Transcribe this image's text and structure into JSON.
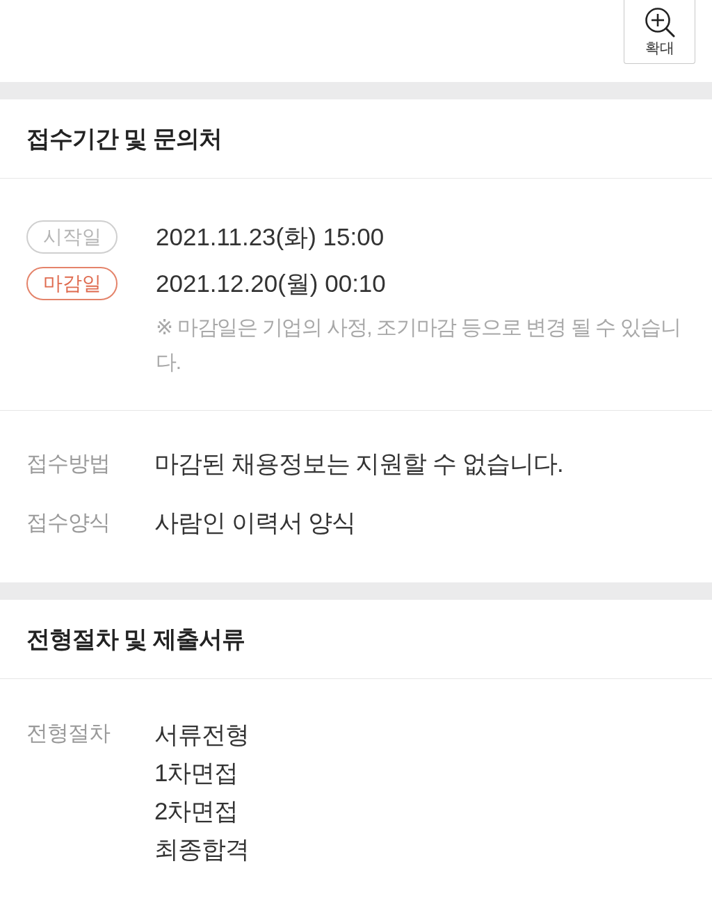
{
  "zoom_button": {
    "label": "확대"
  },
  "sections": [
    {
      "title": "접수기간 및 문의처",
      "schedule": [
        {
          "kind": "start",
          "label": "시작일",
          "value": "2021.11.23(화) 15:00"
        },
        {
          "kind": "deadline",
          "label": "마감일",
          "value": "2021.12.20(월) 00:10"
        }
      ],
      "note": "※ 마감일은 기업의 사정, 조기마감 등으로 변경 될 수 있습니다.",
      "fields": [
        {
          "label": "접수방법",
          "values": [
            "마감된 채용정보는 지원할 수 없습니다."
          ]
        },
        {
          "label": "접수양식",
          "values": [
            "사람인 이력서 양식"
          ]
        }
      ]
    },
    {
      "title": "전형절차 및 제출서류",
      "fields": [
        {
          "label": "전형절차",
          "values": [
            "서류전형",
            "1차면접",
            "2차면접",
            "최종합격"
          ]
        }
      ]
    }
  ]
}
